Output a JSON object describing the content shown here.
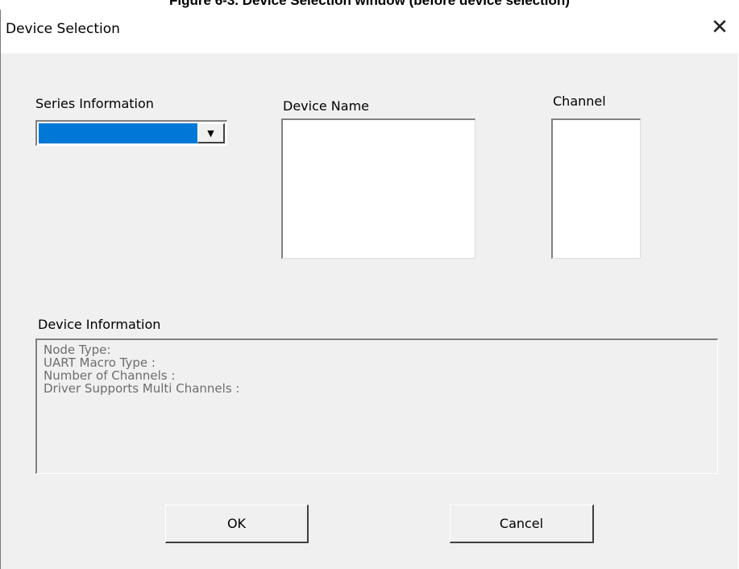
{
  "caption": "Figure 6-3. Device Selection window (before device selection)",
  "window": {
    "title": "Device Selection",
    "close_glyph": "✕"
  },
  "series": {
    "label": "Series Information",
    "selected_value": "",
    "arrow_glyph": "▼"
  },
  "device_name": {
    "label": "Device Name",
    "items": []
  },
  "channel": {
    "label": "Channel",
    "items": []
  },
  "device_info": {
    "label": "Device Information",
    "lines": [
      "Node Type:",
      "UART Macro Type :",
      "Number of Channels :",
      "Driver Supports Multi Channels :"
    ]
  },
  "buttons": {
    "ok": "OK",
    "cancel": "Cancel"
  },
  "colors": {
    "selection": "#0078d7",
    "dialog_bg": "#f0f0f0"
  }
}
